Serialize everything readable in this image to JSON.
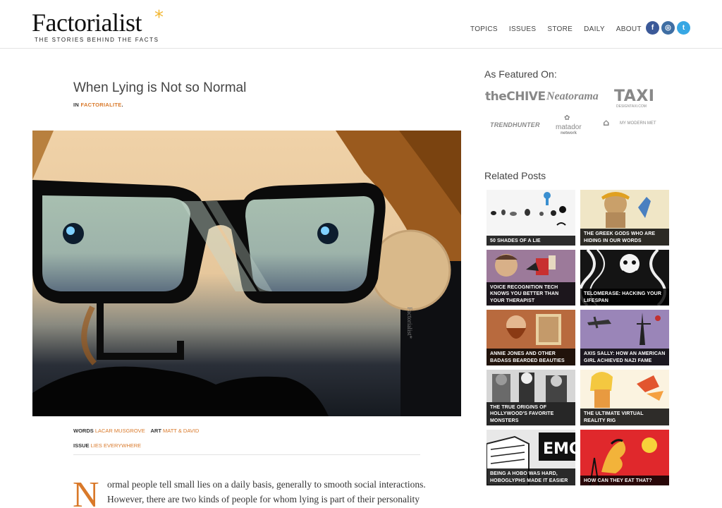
{
  "brand": {
    "name": "Factorialist",
    "star": "*",
    "tagline": "THE STORIES BEHIND THE FACTS"
  },
  "nav": {
    "items": [
      "TOPICS",
      "ISSUES",
      "STORE",
      "DAILY",
      "ABOUT"
    ]
  },
  "social": {
    "facebook": "f",
    "instagram": "◎",
    "twitter": "t"
  },
  "article": {
    "title": "When Lying is Not so Normal",
    "category_prefix": "IN",
    "category": "FACTORIALITE",
    "category_suffix": ".",
    "image_watermark": "Factorialist*",
    "words_label": "WORDS",
    "words_author": "LACAR MUSGROVE",
    "art_label": "ART",
    "art_author": "MATT & DAVID",
    "issue_label": "ISSUE",
    "issue_name": "LIES EVERYWHERE",
    "dropcap": "N",
    "body": "ormal people tell small lies on a daily basis, generally to smooth social interactions. However, there are two kinds of people for whom lying is part of their personality disorder."
  },
  "sidebar": {
    "featured_heading": "As Featured On:",
    "partners": [
      "theCHIVE",
      "Neatorama",
      "TAXI",
      "DESIGNTAXI.COM",
      "TRENDHUNTER",
      "matador",
      "network",
      "MY MODERN MET"
    ],
    "related_heading": "Related Posts",
    "related": [
      "50 SHADES OF A LIE",
      "THE GREEK GODS WHO ARE HIDING IN OUR WORDS",
      "VOICE RECOGNITION TECH KNOWS YOU BETTER THAN YOUR THERAPIST",
      "TELOMERASE: HACKING YOUR LIFESPAN",
      "ANNIE JONES AND OTHER BADASS BEARDED BEAUTIES",
      "AXIS SALLY: HOW AN AMERICAN GIRL ACHIEVED NAZI FAME",
      "THE TRUE ORIGINS OF HOLLYWOOD'S FAVORITE MONSTERS",
      "THE ULTIMATE VIRTUAL REALITY RIG",
      "BEING A HOBO WAS HARD, HOBOGLYPHS MADE IT EASIER",
      "HOW CAN THEY EAT THAT?"
    ],
    "related_images": {
      "emo_sign": "EMO"
    }
  },
  "colors": {
    "accent": "#d9792a",
    "logo_star": "#f2b630",
    "facebook": "#3b5998",
    "instagram": "#3f6ea3",
    "twitter": "#37a7e4"
  }
}
